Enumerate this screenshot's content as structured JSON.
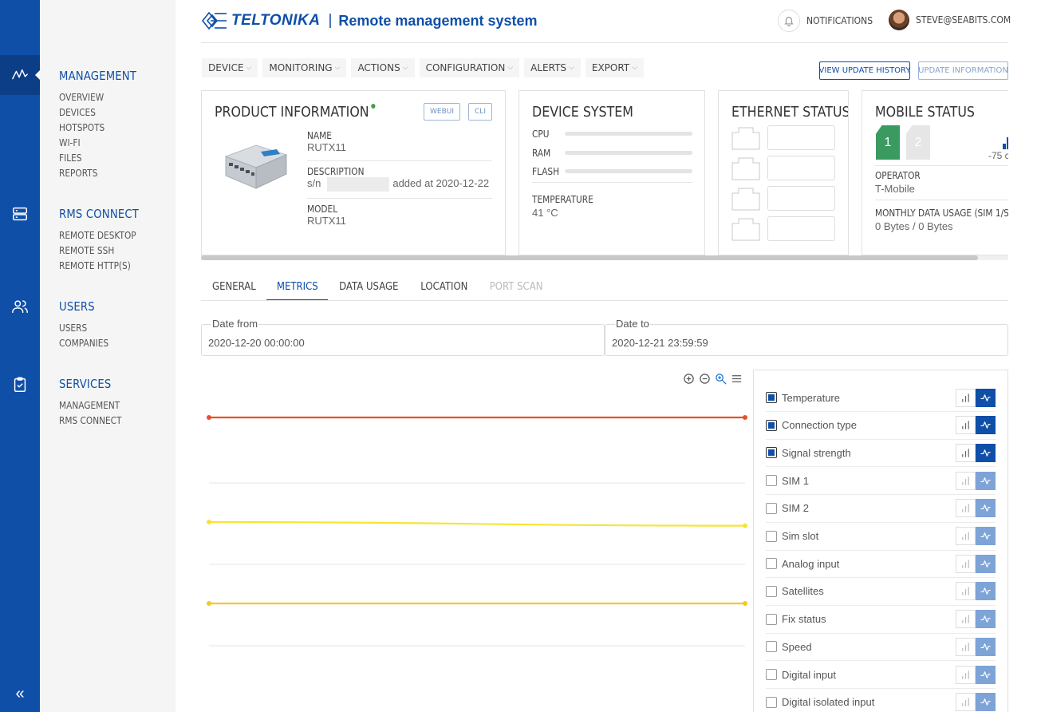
{
  "app": {
    "brand": "TELTONIKA",
    "title": "Remote management system"
  },
  "header": {
    "notifications_label": "NOTIFICATIONS",
    "user_email": "STEVE@SEABITS.COM"
  },
  "rail": {
    "collapse_glyph": "«",
    "icons": [
      "activity-icon",
      "server-icon",
      "users-icon",
      "clipboard-check-icon"
    ]
  },
  "sidebar": {
    "sections": [
      {
        "title": "MANAGEMENT",
        "items": [
          "OVERVIEW",
          "DEVICES",
          "HOTSPOTS",
          "WI-FI",
          "FILES",
          "REPORTS"
        ]
      },
      {
        "title": "RMS CONNECT",
        "items": [
          "REMOTE DESKTOP",
          "REMOTE SSH",
          "REMOTE HTTP(S)"
        ]
      },
      {
        "title": "USERS",
        "items": [
          "USERS",
          "COMPANIES"
        ]
      },
      {
        "title": "SERVICES",
        "items": [
          "MANAGEMENT",
          "RMS CONNECT"
        ]
      }
    ]
  },
  "menu": {
    "items": [
      "DEVICE",
      "MONITORING",
      "ACTIONS",
      "CONFIGURATION",
      "ALERTS",
      "EXPORT"
    ],
    "view_update_history": "VIEW UPDATE HISTORY",
    "update_information": "UPDATE INFORMATION"
  },
  "product_info": {
    "title": "PRODUCT INFORMATION",
    "status_color": "#43a047",
    "webui_label": "WEBUI",
    "cli_label": "CLI",
    "name_label": "NAME",
    "name_value": "RUTX11",
    "description_label": "DESCRIPTION",
    "serial_prefix": "s/n",
    "added_text": "added at 2020-12-22",
    "model_label": "MODEL",
    "model_value": "RUTX11"
  },
  "device_system": {
    "title": "DEVICE SYSTEM",
    "cpu_label": "CPU",
    "ram_label": "RAM",
    "flash_label": "FLASH",
    "temperature_label": "TEMPERATURE",
    "temperature_value": "41 °C"
  },
  "ethernet_status": {
    "title": "ETHERNET STATUS"
  },
  "mobile_status": {
    "title": "MOBILE STATUS",
    "sim1_label": "1",
    "sim2_label": "2",
    "signal_value": "-75 c",
    "operator_label": "OPERATOR",
    "operator_value": "T-Mobile",
    "usage_label": "MONTHLY DATA USAGE (SIM 1/SI",
    "usage_value": "0 Bytes / 0 Bytes"
  },
  "tabs": [
    {
      "label": "GENERAL",
      "state": "normal"
    },
    {
      "label": "METRICS",
      "state": "active"
    },
    {
      "label": "DATA USAGE",
      "state": "normal"
    },
    {
      "label": "LOCATION",
      "state": "normal"
    },
    {
      "label": "PORT SCAN",
      "state": "disabled"
    }
  ],
  "filters": {
    "date_from_label": "Date from",
    "date_from_value": "2020-12-20 00:00:00",
    "date_to_label": "Date to",
    "date_to_value": "2020-12-21 23:59:59"
  },
  "chart_data": {
    "type": "line",
    "title": "",
    "xlabel": "",
    "ylabel": "",
    "grid": true,
    "series": [
      {
        "name": "Temperature",
        "color": "#e8502a",
        "values": [
          0.0,
          0.0
        ]
      },
      {
        "name": "Connection type",
        "color": "#f6e533",
        "values": [
          0.0,
          -0.3
        ]
      },
      {
        "name": "Signal strength",
        "color": "#f3c928",
        "values": [
          0.0,
          0.0
        ]
      }
    ]
  },
  "legend": {
    "items": [
      {
        "label": "Temperature",
        "checked": true
      },
      {
        "label": "Connection type",
        "checked": true
      },
      {
        "label": "Signal strength",
        "checked": true
      },
      {
        "label": "SIM 1",
        "checked": false
      },
      {
        "label": "SIM 2",
        "checked": false
      },
      {
        "label": "Sim slot",
        "checked": false
      },
      {
        "label": "Analog input",
        "checked": false
      },
      {
        "label": "Satellites",
        "checked": false
      },
      {
        "label": "Fix status",
        "checked": false
      },
      {
        "label": "Speed",
        "checked": false
      },
      {
        "label": "Digital input",
        "checked": false
      },
      {
        "label": "Digital isolated input",
        "checked": false
      }
    ]
  },
  "colors": {
    "brand": "#0f4fa8",
    "sidebar_bg": "#f5f5f5"
  }
}
